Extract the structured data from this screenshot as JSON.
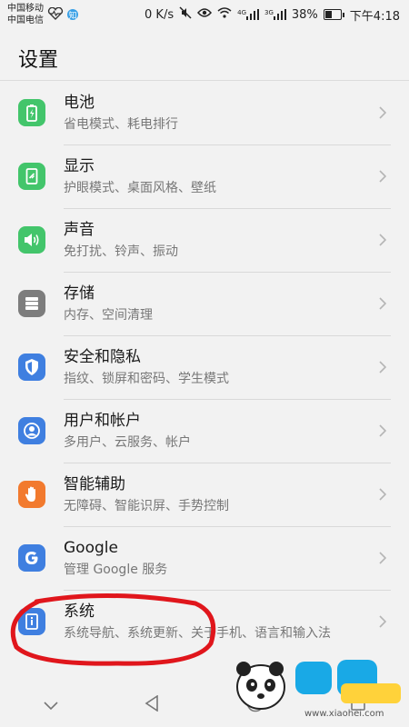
{
  "status_bar": {
    "carrier1": "中国移动",
    "carrier2": "中国电信",
    "speed": "0 K/s",
    "net4g": "4G",
    "net3g": "3G",
    "battery": "38%",
    "time": "下午4:18"
  },
  "header": {
    "title": "设置"
  },
  "settings": [
    {
      "title": "电池",
      "subtitle": "省电模式、耗电排行",
      "icon": "battery-icon",
      "color": "#43c56b"
    },
    {
      "title": "显示",
      "subtitle": "护眼模式、桌面风格、壁纸",
      "icon": "display-icon",
      "color": "#43c56b"
    },
    {
      "title": "声音",
      "subtitle": "免打扰、铃声、振动",
      "icon": "speaker-icon",
      "color": "#43c56b"
    },
    {
      "title": "存储",
      "subtitle": "内存、空间清理",
      "icon": "storage-icon",
      "color": "#7d7d7d"
    },
    {
      "title": "安全和隐私",
      "subtitle": "指纹、锁屏和密码、学生模式",
      "icon": "shield-icon",
      "color": "#3f7fe0"
    },
    {
      "title": "用户和帐户",
      "subtitle": "多用户、云服务、帐户",
      "icon": "user-icon",
      "color": "#3f7fe0"
    },
    {
      "title": "智能辅助",
      "subtitle": "无障碍、智能识屏、手势控制",
      "icon": "hand-icon",
      "color": "#f27a2e"
    },
    {
      "title": "Google",
      "subtitle": "管理 Google 服务",
      "icon": "google-icon",
      "color": "#3f7fe0"
    },
    {
      "title": "系统",
      "subtitle": "系统导航、系统更新、关于手机、语言和输入法",
      "icon": "info-icon",
      "color": "#3f7fe0"
    }
  ],
  "watermark": {
    "text": "www.xiaohei.com"
  }
}
